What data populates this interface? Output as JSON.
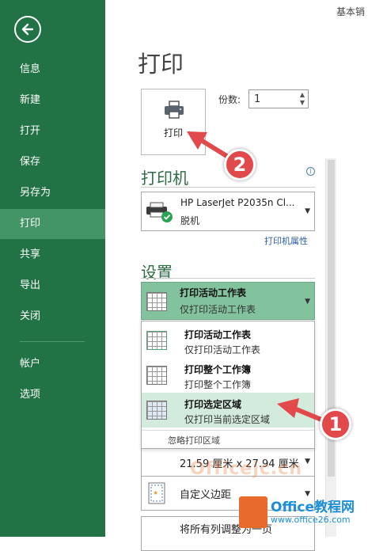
{
  "app": {
    "doc_title": "基本销"
  },
  "sidebar": {
    "items": [
      {
        "label": "信息"
      },
      {
        "label": "新建"
      },
      {
        "label": "打开"
      },
      {
        "label": "保存"
      },
      {
        "label": "另存为"
      },
      {
        "label": "打印",
        "active": true
      },
      {
        "label": "共享"
      },
      {
        "label": "导出"
      },
      {
        "label": "关闭"
      },
      {
        "label": "帐户"
      },
      {
        "label": "选项"
      }
    ]
  },
  "main": {
    "title": "打印",
    "print_button_label": "打印",
    "copies_label": "份数:",
    "copies_value": "1",
    "printer_section": "打印机",
    "printer_name": "HP LaserJet P2035n Cl...",
    "printer_status": "脱机",
    "printer_properties": "打印机属性",
    "settings_section": "设置",
    "scope": {
      "title": "打印活动工作表",
      "subtitle": "仅打印活动工作表"
    },
    "options": [
      {
        "title": "打印活动工作表",
        "subtitle": "仅打印活动工作表"
      },
      {
        "title": "打印整个工作簿",
        "subtitle": "打印整个工作簿"
      },
      {
        "title": "打印选定区域",
        "subtitle": "仅打印当前选定区域",
        "selected": true
      }
    ],
    "ignore_print_area": "忽略打印区域",
    "paper_size": "21.59 厘米 x 27.94 厘米",
    "margins": "自定义边距",
    "scaling": "将所有列调整为一页"
  },
  "callouts": [
    "1",
    "2"
  ],
  "watermark": {
    "site": "Officejc.cn",
    "logo_name": "Office教程网",
    "logo_url": "www.office26.com"
  },
  "colors": {
    "sidebar": "#217346",
    "active_nav": "#439467",
    "selected_option": "#d3ebdc",
    "callout": "#e2494a"
  }
}
